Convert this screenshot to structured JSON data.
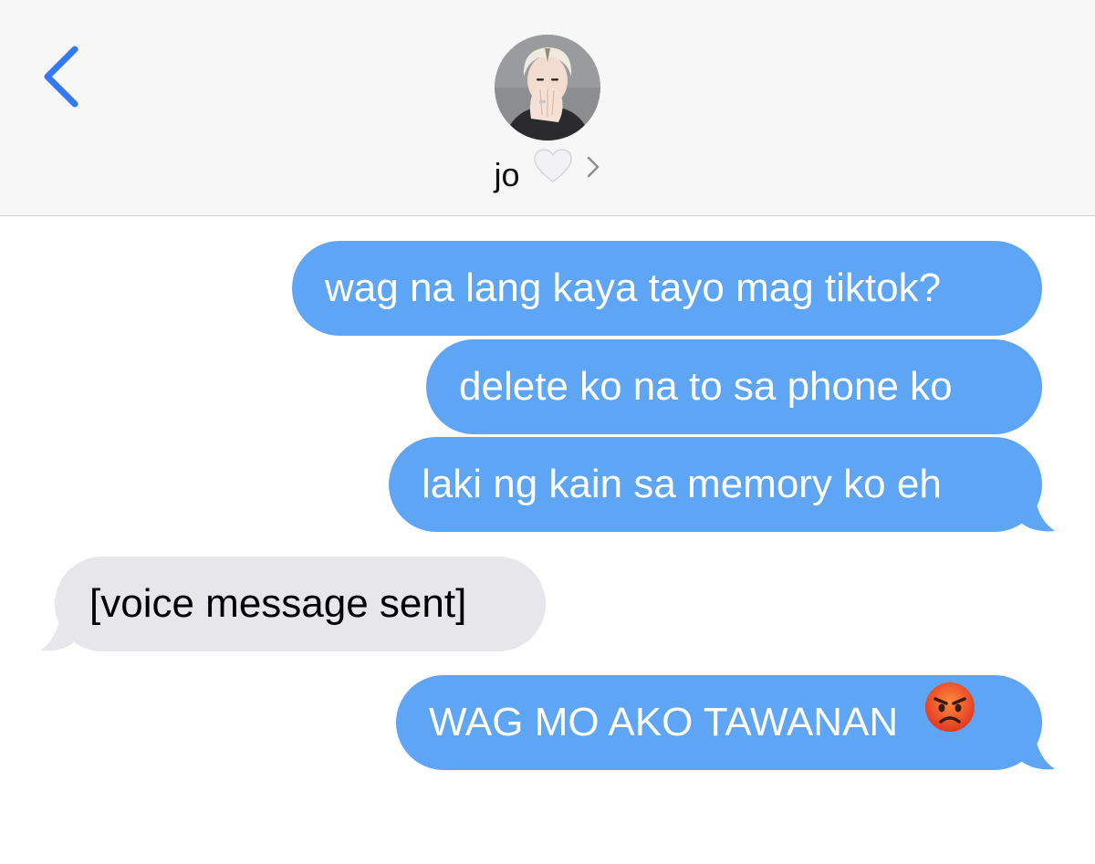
{
  "header": {
    "back_icon": "chevron-left-icon",
    "contact_name": "jo",
    "contact_emoji": "🤍",
    "details_chevron": "›"
  },
  "colors": {
    "accent": "#3478f6",
    "outgoing_bubble": "#5ea6f5",
    "incoming_bubble": "#e6e6eb",
    "header_bg": "#f7f7f7"
  },
  "messages": [
    {
      "direction": "outgoing",
      "text": "wag na lang kaya tayo mag tiktok?"
    },
    {
      "direction": "outgoing",
      "text": "delete ko na to sa phone ko"
    },
    {
      "direction": "outgoing",
      "text": "laki ng kain sa memory ko eh"
    },
    {
      "direction": "incoming",
      "text": "[voice message sent]"
    },
    {
      "direction": "outgoing",
      "text": "WAG MO AKO TAWANAN",
      "emoji": "😡"
    }
  ]
}
